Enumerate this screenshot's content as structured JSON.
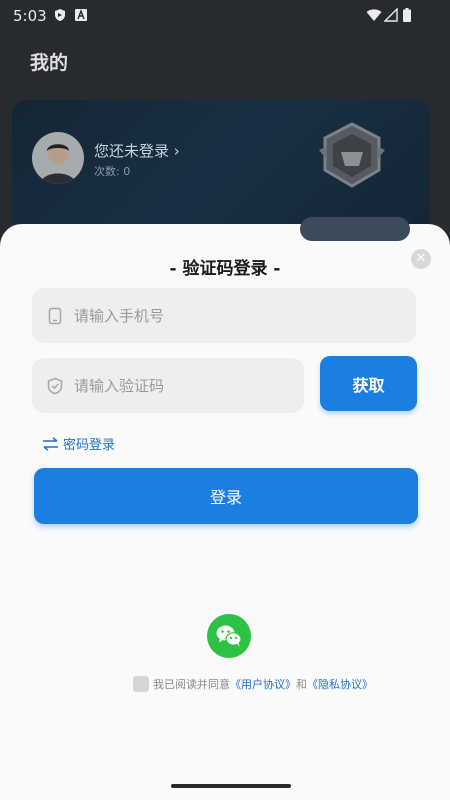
{
  "status_bar": {
    "time": "5:03"
  },
  "background": {
    "page_title": "我的",
    "profile": {
      "login_prompt": "您还未登录",
      "count_text": "次数: 0"
    }
  },
  "sheet": {
    "title": "- 验证码登录 -",
    "phone_placeholder": "请输入手机号",
    "code_placeholder": "请输入验证码",
    "get_code_label": "获取",
    "password_login_label": "密码登录",
    "login_label": "登录",
    "agreement": {
      "prefix": "我已阅读并同意",
      "user_agreement": "《用户协议》",
      "conjunction": "和",
      "privacy_policy": "《隐私协议》"
    }
  },
  "icons": {
    "close": "close-icon",
    "phone": "phone-icon",
    "shield": "shield-icon",
    "swap": "swap-icon",
    "wechat": "wechat-icon"
  },
  "colors": {
    "primary": "#1a7fe0",
    "link": "#2170c8",
    "wechat": "#2dc245",
    "field_bg": "#eeeeee"
  }
}
